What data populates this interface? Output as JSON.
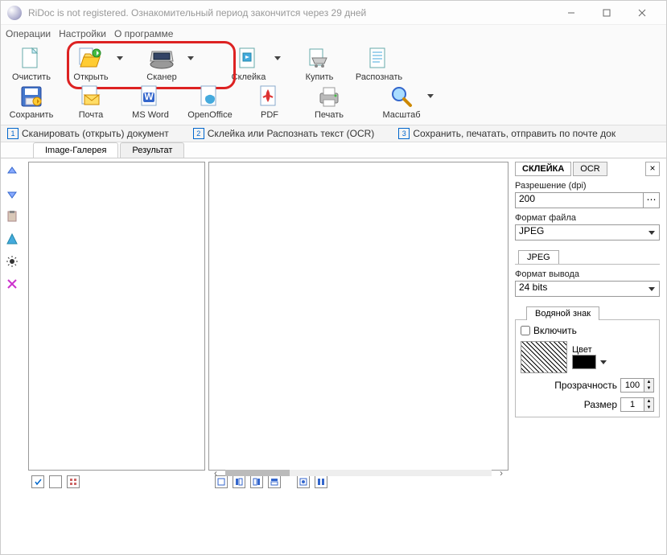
{
  "title": "RiDoc is not registered. Ознакомительный период закончится через 29 дней",
  "menu": {
    "operations": "Операции",
    "settings": "Настройки",
    "about": "О программе"
  },
  "toolbar1": {
    "clear": "Очистить",
    "open": "Открыть",
    "scanner": "Сканер",
    "glue": "Склейка",
    "buy": "Купить",
    "recognize": "Распознать"
  },
  "toolbar2": {
    "save": "Сохранить",
    "mail": "Почта",
    "msword": "MS Word",
    "openoffice": "OpenOffice",
    "pdf": "PDF",
    "print": "Печать",
    "zoom": "Масштаб"
  },
  "steps": {
    "s1": "Сканировать (открыть) документ",
    "s2": "Склейка или Распознать текст (OCR)",
    "s3": "Сохранить, печатать, отправить по почте док"
  },
  "tabs": {
    "gallery": "Image-Галерея",
    "result": "Результат"
  },
  "right": {
    "tab_glue": "СКЛЕЙКА",
    "tab_ocr": "OCR",
    "dpi_label": "Разрешение (dpi)",
    "dpi_value": "200",
    "format_label": "Формат файла",
    "format_value": "JPEG",
    "jpeg_tab": "JPEG",
    "output_label": "Формат вывода",
    "output_value": "24 bits",
    "watermark_label": "Водяной знак",
    "enable_label": "Включить",
    "color_label": "Цвет",
    "opacity_label": "Прозрачность",
    "opacity_value": "100",
    "size_label": "Размер",
    "size_value": "1"
  }
}
